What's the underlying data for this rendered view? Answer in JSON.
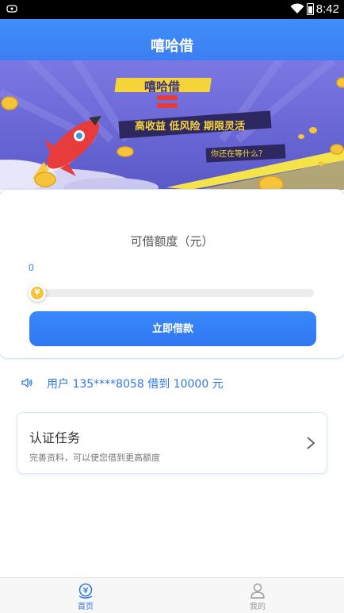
{
  "status_bar": {
    "time": "8:42"
  },
  "header": {
    "title": "嘻哈借"
  },
  "banner": {
    "brand": "嘻哈借",
    "slogan": "高收益 低风险 期限灵活",
    "tagline": "你还在等什么？"
  },
  "loan": {
    "label": "可借额度（元）",
    "value": "0",
    "slider_level": 0,
    "knob_symbol": "¥",
    "button_label": "立即借款"
  },
  "notice": {
    "text": "用户 135****8058 借到 10000 元"
  },
  "task": {
    "title": "认证任务",
    "description": "完善资料，可以使您借到更高额度"
  },
  "tabbar": {
    "home_label": "首页",
    "mine_label": "我的"
  },
  "colors": {
    "primary": "#3c84f6",
    "banner_bg": "#6a68d6",
    "coin": "#f6c43b",
    "notice_text": "#2f78e4"
  }
}
